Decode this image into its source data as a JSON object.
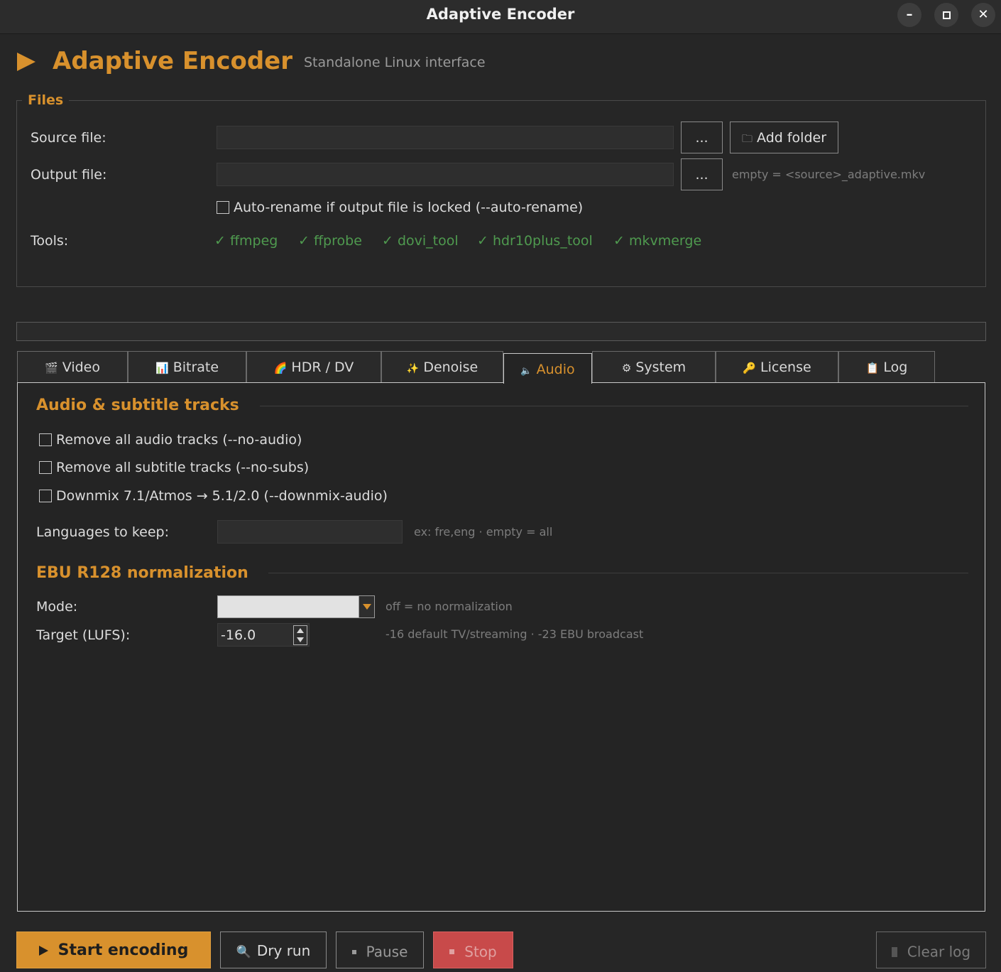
{
  "window": {
    "title": "Adaptive Encoder",
    "minimize_icon": "minimize-icon",
    "maximize_icon": "maximize-icon",
    "close_icon": "close-icon"
  },
  "header": {
    "app_name": "Adaptive Encoder",
    "subtitle": "Standalone Linux interface",
    "accent_color": "#d8912d"
  },
  "files": {
    "legend": "Files",
    "source_label": "Source file:",
    "source_value": "",
    "browse_label": "...",
    "add_folder_label": "Add folder",
    "output_label": "Output file:",
    "output_value": "",
    "output_browse_label": "...",
    "output_hint": "empty = <source>_adaptive.mkv",
    "auto_rename_label": "Auto-rename if output file is locked  (--auto-rename)",
    "auto_rename_checked": false,
    "tools_label": "Tools:",
    "tools": [
      "✓ ffmpeg",
      "✓ ffprobe",
      "✓ dovi_tool",
      "✓ hdr10plus_tool",
      "✓ mkvmerge"
    ],
    "tools_color": "#4f9a4f"
  },
  "progress": {
    "value": 0
  },
  "tabs": [
    {
      "icon": "🎬",
      "label": "Video"
    },
    {
      "icon": "📊",
      "label": "Bitrate"
    },
    {
      "icon": "🌈",
      "label": "HDR / DV"
    },
    {
      "icon": "✨",
      "label": "Denoise"
    },
    {
      "icon": "🔈",
      "label": "Audio"
    },
    {
      "icon": "⚙",
      "label": "System"
    },
    {
      "icon": "🔑",
      "label": "License"
    },
    {
      "icon": "📋",
      "label": "Log"
    }
  ],
  "active_tab": "Audio",
  "audio": {
    "section_tracks": "Audio & subtitle tracks",
    "remove_audio": "Remove all audio tracks  (--no-audio)",
    "remove_subs": "Remove all subtitle tracks  (--no-subs)",
    "downmix": "Downmix 7.1/Atmos → 5.1/2.0  (--downmix-audio)",
    "remove_audio_checked": false,
    "remove_subs_checked": false,
    "downmix_checked": false,
    "languages_label": "Languages to keep:",
    "languages_value": "",
    "languages_hint": "ex: fre,eng  ·  empty = all",
    "section_ebu": "EBU R128 normalization",
    "mode_label": "Mode:",
    "mode_value": "",
    "mode_hint": "off = no normalization",
    "target_label": "Target (LUFS):",
    "target_value": "-16.0",
    "target_hint": "-16 default TV/streaming  ·  -23 EBU broadcast"
  },
  "actions": {
    "start": "Start encoding",
    "dry_run": "Dry run",
    "pause": "Pause",
    "stop": "Stop",
    "clear_log": "Clear log",
    "stop_color": "#c84a4a"
  }
}
